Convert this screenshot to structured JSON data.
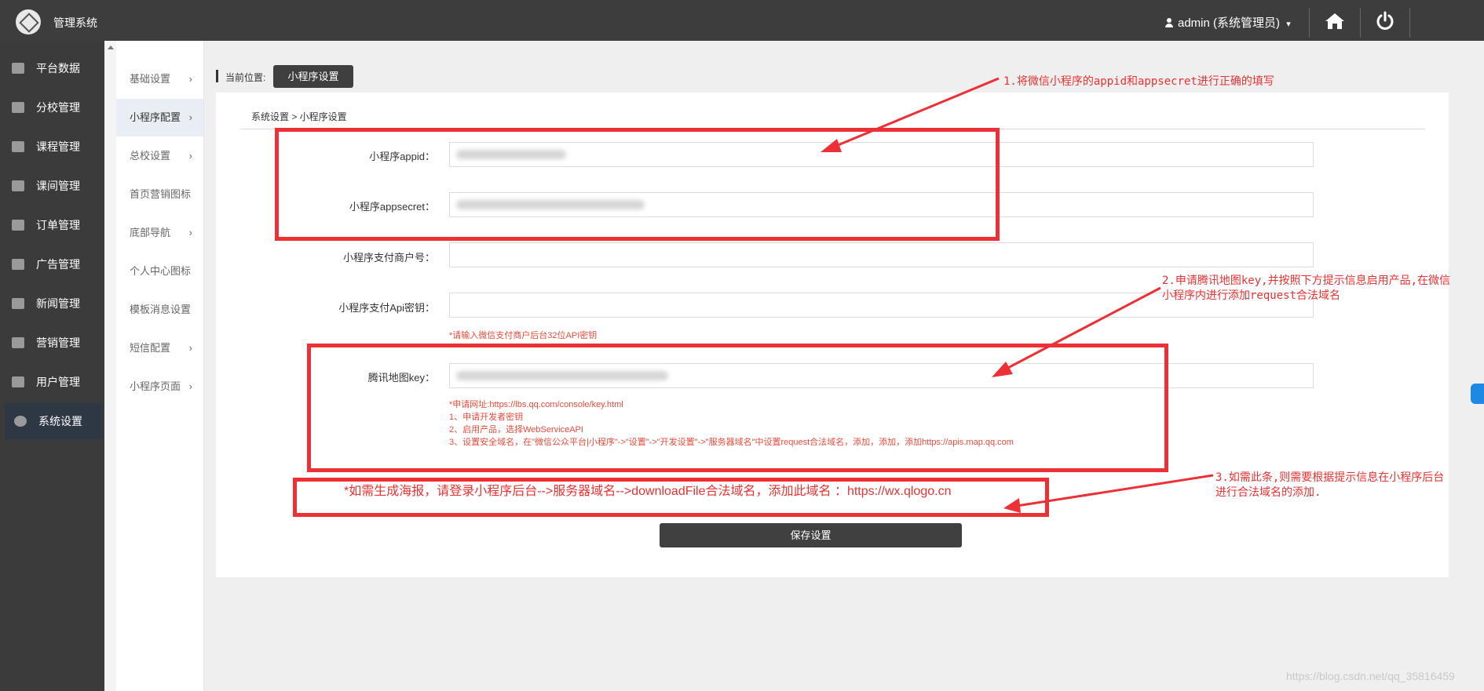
{
  "topbar": {
    "app_title": "管理系统",
    "user_label": "admin (系统管理员)",
    "user_caret": "▾",
    "home_icon": "home-icon",
    "power_icon": "power-icon"
  },
  "sidebar": {
    "items": [
      {
        "label": "平台数据",
        "icon": "chart-line-icon"
      },
      {
        "label": "分校管理",
        "icon": "building-icon"
      },
      {
        "label": "课程管理",
        "icon": "book-icon"
      },
      {
        "label": "课间管理",
        "icon": "support-icon"
      },
      {
        "label": "订单管理",
        "icon": "money-icon"
      },
      {
        "label": "广告管理",
        "icon": "bell-icon"
      },
      {
        "label": "新闻管理",
        "icon": "newspaper-icon"
      },
      {
        "label": "营销管理",
        "icon": "gift-icon"
      },
      {
        "label": "用户管理",
        "icon": "user-icon"
      },
      {
        "label": "系统设置",
        "icon": "gear-icon",
        "active": true
      }
    ]
  },
  "submenu": {
    "items": [
      {
        "label": "基础设置",
        "chevron": "›"
      },
      {
        "label": "小程序配置",
        "chevron": "›",
        "active": true
      },
      {
        "label": "总校设置",
        "chevron": "›"
      },
      {
        "label": "首页营销图标",
        "chevron": ""
      },
      {
        "label": "底部导航",
        "chevron": "›"
      },
      {
        "label": "个人中心图标",
        "chevron": ""
      },
      {
        "label": "模板消息设置",
        "chevron": ""
      },
      {
        "label": "短信配置",
        "chevron": "›"
      },
      {
        "label": "小程序页面",
        "chevron": "›"
      }
    ]
  },
  "content": {
    "location_label": "当前位置:",
    "location_tab": "小程序设置",
    "breadcrumb": "系统设置 > 小程序设置",
    "fields": {
      "appid_label": "小程序appid：",
      "appsecret_label": "小程序appsecret：",
      "merchant_label": "小程序支付商户号：",
      "apikey_label": "小程序支付Api密钥：",
      "apikey_hint": "*请输入微信支付商户后台32位API密钥",
      "mapkey_label": "腾讯地图key：",
      "map_hints": [
        "*申请网址:https://lbs.qq.com/console/key.html",
        "1、申请开发者密钥",
        "2、启用产品，选择WebServiceAPI",
        "3、设置安全域名，在\"微信公众平台|小程序\"->\"设置\"->\"开发设置\"->\"服务器域名\"中设置request合法域名，添加，添加，添加https://apis.map.qq.com"
      ]
    },
    "poster_note": "*如需生成海报，请登录小程序后台-->服务器域名-->downloadFile合法域名，添加此域名 ：https://wx.qlogo.cn",
    "save_button": "保存设置"
  },
  "annotations": {
    "note1": "1.将微信小程序的appid和appsecret进行正确的填写",
    "note2_line1": "2.申请腾讯地图key,并按照下方提示信息启用产品,在微信",
    "note2_line2": "小程序内进行添加request合法域名",
    "note3_line1": "3.如需此条,则需要根据提示信息在小程序后台",
    "note3_line2": "进行合法域名的添加."
  },
  "watermark": "https://blog.csdn.net/qq_35816459",
  "colors": {
    "topbar": "#3d3d3d",
    "sidebar": "#3b3b3b",
    "sidebar_active": "#2e3744",
    "annotation_red": "#ec3035",
    "hint_red": "#e74c3c"
  }
}
